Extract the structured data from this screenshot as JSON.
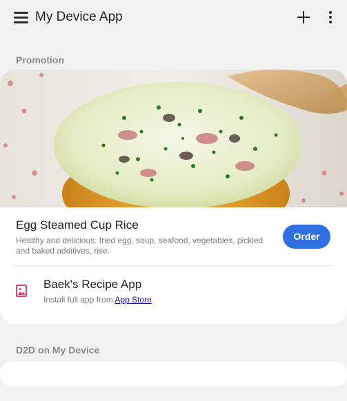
{
  "appbar": {
    "title": "My Device App",
    "icons": [
      "menu-icon",
      "add-icon",
      "more-vert-icon"
    ]
  },
  "promotion": {
    "section_label": "Promotion",
    "dish": {
      "title": "Egg Steamed Cup Rice",
      "description": "Healthy and delicious: fried egg, soup, seafood, vegetables, pickled and baked additives, rise.",
      "order_label": "Order"
    },
    "app": {
      "icon": "image-icon",
      "name": "Baek's Recipe App",
      "install_prefix": "Install full app from",
      "install_link": "App Store"
    }
  },
  "d2d": {
    "section_label": "D2D on My Device"
  },
  "colors": {
    "background": "#f2f2f2",
    "card": "#ffffff",
    "accent": "#2f6fe0",
    "link": "#1a0dab",
    "icon_pink": "#d9457a"
  }
}
